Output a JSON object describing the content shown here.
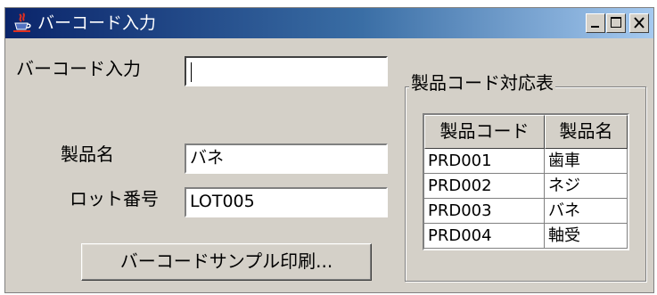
{
  "window": {
    "title": "バーコード入力",
    "icon": "java-cup-icon",
    "controls": [
      "minimize-icon",
      "maximize-icon",
      "close-icon"
    ]
  },
  "form": {
    "barcode_label": "バーコード入力",
    "barcode_value": "",
    "product_name_label": "製品名",
    "product_name_value": "バネ",
    "lot_label": "ロット番号",
    "lot_value": "LOT005",
    "print_button_label": "バーコードサンプル印刷..."
  },
  "product_table": {
    "group_title": "製品コード対応表",
    "columns": [
      "製品コード",
      "製品名"
    ],
    "rows": [
      [
        "PRD001",
        "歯車"
      ],
      [
        "PRD002",
        "ネジ"
      ],
      [
        "PRD003",
        "バネ"
      ],
      [
        "PRD004",
        "軸受"
      ]
    ]
  }
}
